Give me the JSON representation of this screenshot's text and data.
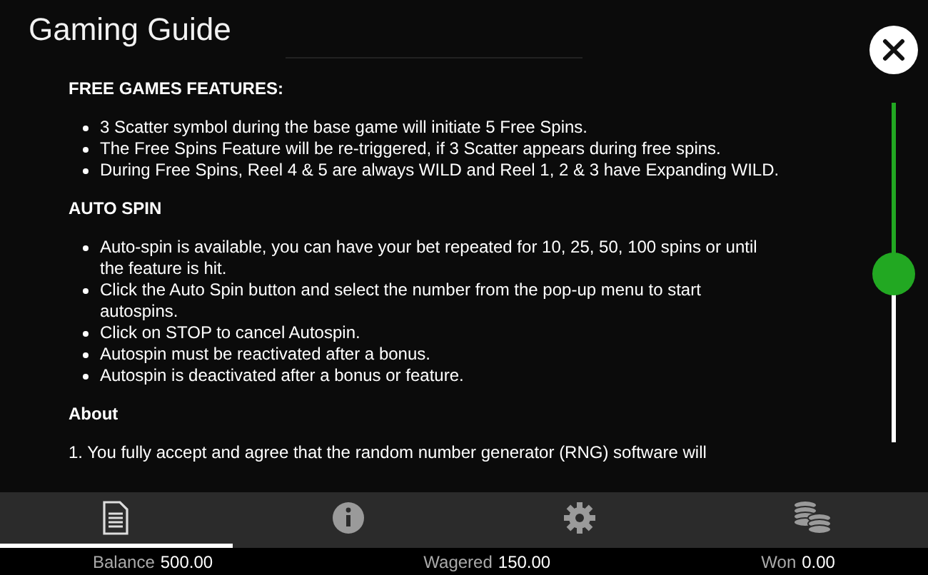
{
  "title": "Gaming Guide",
  "sections": [
    {
      "heading": "FREE GAMES FEATURES:",
      "kind": "bullets",
      "items": [
        "3 Scatter symbol during the base game will initiate 5 Free Spins.",
        "The Free Spins Feature will be re-triggered, if 3 Scatter appears during free spins.",
        "During Free Spins, Reel 4 & 5 are always WILD and Reel 1, 2 & 3 have Expanding WILD."
      ]
    },
    {
      "heading": "AUTO SPIN",
      "kind": "bullets",
      "items": [
        "Auto-spin is available, you can have your bet repeated for 10, 25, 50, 100 spins or until the feature is hit.",
        "Click the Auto Spin button and select the number from the pop-up menu to start autospins.",
        "Click on STOP to cancel Autospin.",
        "Autospin must be reactivated after a bonus.",
        "Autospin is deactivated after a bonus or feature."
      ]
    },
    {
      "heading": "About",
      "kind": "paragraphs",
      "items": [
        "1. You fully accept and agree that the random number generator (RNG) software will"
      ]
    }
  ],
  "tabs": [
    {
      "kind": "document",
      "selected": true
    },
    {
      "kind": "info",
      "selected": false
    },
    {
      "kind": "gear",
      "selected": false
    },
    {
      "kind": "coins",
      "selected": false
    }
  ],
  "status_bar": [
    {
      "label": "Balance",
      "value": "500.00"
    },
    {
      "label": "Wagered",
      "value": "150.00"
    },
    {
      "label": "Won",
      "value": "0.00"
    }
  ]
}
